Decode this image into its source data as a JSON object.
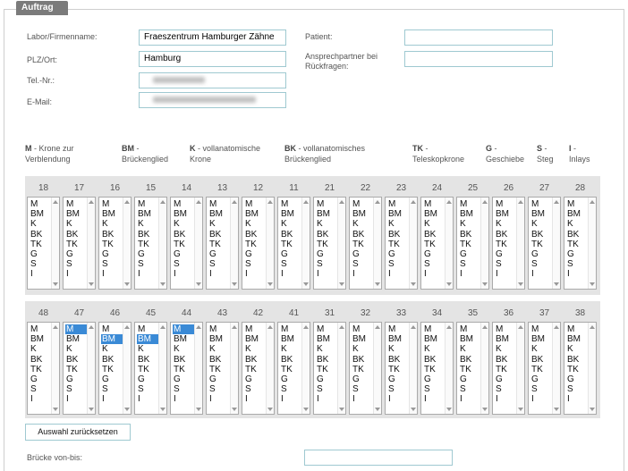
{
  "fieldset": {
    "title": "Auftrag"
  },
  "form": {
    "labor_label": "Labor/Firmenname:",
    "labor_value": "Fraeszentrum Hamburger Zähne",
    "plz_label": "PLZ/Ort:",
    "plz_value": "Hamburg",
    "tel_label": "Tel.-Nr.:",
    "email_label": "E-Mail:",
    "patient_label": "Patient:",
    "patient_value": "",
    "ansprech_label": "Ansprechpartner bei Rückfragen:",
    "ansprech_value": ""
  },
  "legend": [
    {
      "code": "M",
      "desc": " - Krone zur Verblendung"
    },
    {
      "code": "BM",
      "desc": " - Brückenglied"
    },
    {
      "code": "K",
      "desc": " - vollanatomische Krone"
    },
    {
      "code": "BK",
      "desc": " - vollanatomisches Brückenglied"
    },
    {
      "code": "TK",
      "desc": " - Teleskopkrone"
    },
    {
      "code": "G",
      "desc": " - Geschiebe"
    },
    {
      "code": "S",
      "desc": " - Steg"
    },
    {
      "code": "I",
      "desc": " - Inlays"
    }
  ],
  "options": [
    "M",
    "BM",
    "K",
    "BK",
    "TK",
    "G",
    "S",
    "I"
  ],
  "upper_teeth": [
    {
      "num": "18",
      "selected": ""
    },
    {
      "num": "17",
      "selected": ""
    },
    {
      "num": "16",
      "selected": ""
    },
    {
      "num": "15",
      "selected": ""
    },
    {
      "num": "14",
      "selected": ""
    },
    {
      "num": "13",
      "selected": ""
    },
    {
      "num": "12",
      "selected": ""
    },
    {
      "num": "11",
      "selected": ""
    },
    {
      "num": "21",
      "selected": ""
    },
    {
      "num": "22",
      "selected": ""
    },
    {
      "num": "23",
      "selected": ""
    },
    {
      "num": "24",
      "selected": ""
    },
    {
      "num": "25",
      "selected": ""
    },
    {
      "num": "26",
      "selected": ""
    },
    {
      "num": "27",
      "selected": ""
    },
    {
      "num": "28",
      "selected": ""
    }
  ],
  "lower_teeth": [
    {
      "num": "48",
      "selected": ""
    },
    {
      "num": "47",
      "selected": "M"
    },
    {
      "num": "46",
      "selected": "BM"
    },
    {
      "num": "45",
      "selected": "BM"
    },
    {
      "num": "44",
      "selected": "M"
    },
    {
      "num": "43",
      "selected": ""
    },
    {
      "num": "42",
      "selected": ""
    },
    {
      "num": "41",
      "selected": ""
    },
    {
      "num": "31",
      "selected": ""
    },
    {
      "num": "32",
      "selected": ""
    },
    {
      "num": "33",
      "selected": ""
    },
    {
      "num": "34",
      "selected": ""
    },
    {
      "num": "35",
      "selected": ""
    },
    {
      "num": "36",
      "selected": ""
    },
    {
      "num": "37",
      "selected": ""
    },
    {
      "num": "38",
      "selected": ""
    }
  ],
  "reset_button": "Auswahl zurücksetzen",
  "bruecke": {
    "label": "Brücke von-bis:",
    "value": ""
  },
  "colors": {
    "accent": "#3a8ad6",
    "border": "#9fc9d1",
    "grid": "#e4e4e4",
    "legend_bg": "#7b7b7b"
  }
}
